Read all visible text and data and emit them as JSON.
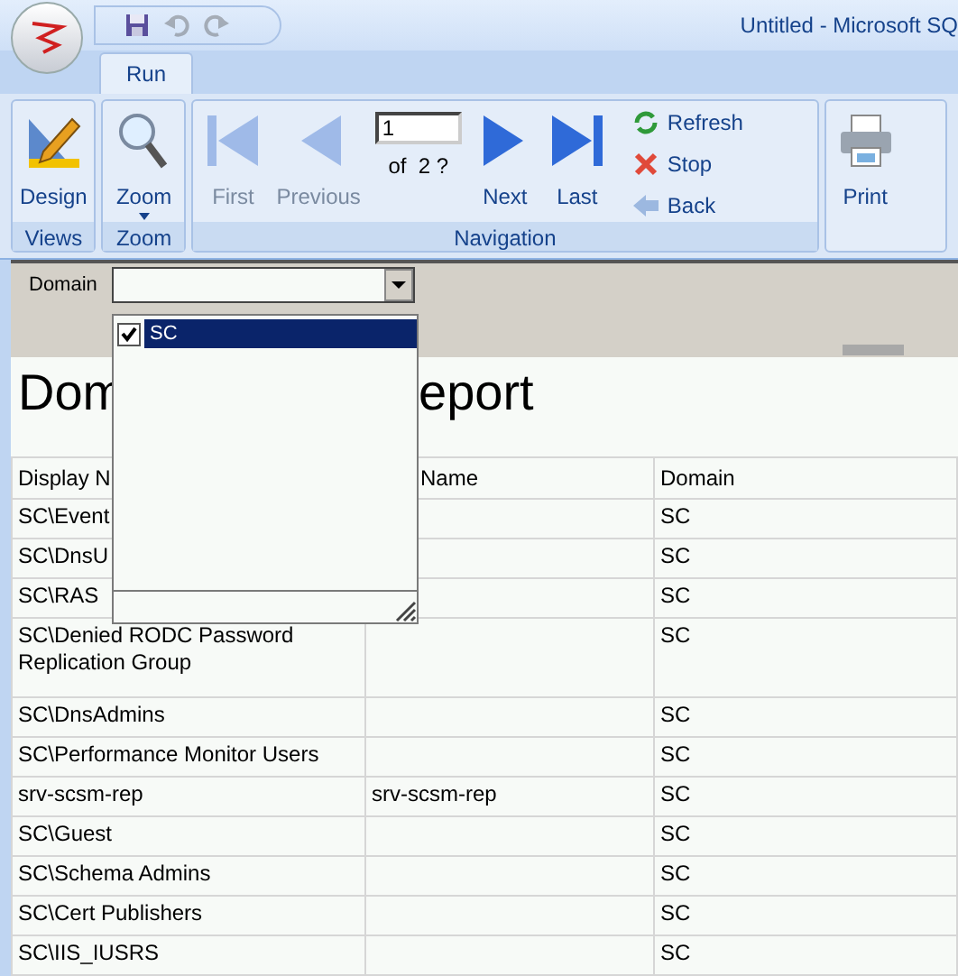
{
  "window": {
    "title": "Untitled - Microsoft SQ"
  },
  "quick_access": [
    {
      "kind": "save",
      "disabled": false
    },
    {
      "kind": "undo",
      "disabled": true
    },
    {
      "kind": "redo",
      "disabled": true
    }
  ],
  "tabs": [
    {
      "label": "Run",
      "selected": true
    }
  ],
  "ribbon": {
    "groups": [
      {
        "label": "Views",
        "buttons": [
          {
            "kind": "design",
            "label": "Design",
            "disabled": false
          }
        ]
      },
      {
        "label": "Zoom",
        "buttons": [
          {
            "kind": "zoom",
            "label": "Zoom",
            "disabled": false
          }
        ]
      },
      {
        "label": "Navigation",
        "buttons": [
          {
            "kind": "first",
            "label": "First",
            "disabled": true
          },
          {
            "kind": "previous",
            "label": "Previous",
            "disabled": true
          }
        ],
        "page": {
          "value": "1",
          "of": "of  2 ?"
        },
        "buttons_after": [
          {
            "kind": "next",
            "label": "Next",
            "disabled": false
          },
          {
            "kind": "last",
            "label": "Last",
            "disabled": false
          }
        ],
        "actions": [
          {
            "kind": "refresh",
            "label": "Refresh"
          },
          {
            "kind": "stop",
            "label": "Stop"
          },
          {
            "kind": "back",
            "label": "Back"
          }
        ]
      },
      {
        "buttons": [
          {
            "kind": "print",
            "label": "Print",
            "disabled": false
          }
        ]
      }
    ]
  },
  "parameters": {
    "label": "Domain",
    "dropdown": {
      "expanded": true,
      "options": [
        {
          "label": "SC",
          "checked": true,
          "selected": true
        }
      ]
    }
  },
  "report": {
    "title_parts": [
      "Dom",
      "eport"
    ],
    "columns": [
      "Display N",
      "Name",
      "Domain"
    ],
    "rows": [
      {
        "cells": [
          "SC\\Event",
          "",
          "SC"
        ]
      },
      {
        "cells": [
          "SC\\DnsU",
          "",
          "SC"
        ]
      },
      {
        "cells": [
          "SC\\RAS",
          "",
          "SC"
        ]
      },
      {
        "cells": [
          "SC\\Denied RODC Password Replication Group",
          "",
          "SC"
        ]
      },
      {
        "cells": [
          "SC\\DnsAdmins",
          "",
          "SC"
        ]
      },
      {
        "cells": [
          "SC\\Performance Monitor Users",
          "",
          "SC"
        ]
      },
      {
        "cells": [
          "srv-scsm-rep",
          "srv-scsm-rep",
          "SC"
        ]
      },
      {
        "cells": [
          "SC\\Guest",
          "",
          "SC"
        ]
      },
      {
        "cells": [
          "SC\\Schema Admins",
          "",
          "SC"
        ]
      },
      {
        "cells": [
          "SC\\Cert Publishers",
          "",
          "SC"
        ]
      },
      {
        "cells": [
          "SC\\IIS_IUSRS",
          "",
          "SC"
        ]
      }
    ]
  }
}
